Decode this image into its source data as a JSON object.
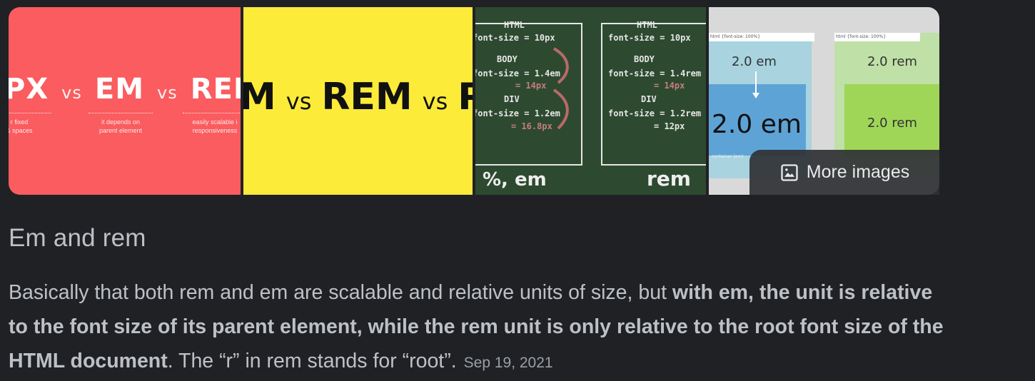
{
  "images": {
    "thumb1": {
      "words": [
        "PX",
        "vs",
        "EM",
        "vs",
        "REM"
      ],
      "captions": [
        "r fixed\n& spaces",
        "it depends on\nparent element",
        "easily scalable i\nresponsiveness"
      ]
    },
    "thumb2": {
      "words": [
        "M",
        "vs",
        "REM",
        "vs",
        "P"
      ]
    },
    "thumb3": {
      "left_lines": [
        "HTML",
        "font-size = 10px",
        "BODY",
        "font-size = 1.4em",
        "= 14px",
        "DIV",
        "font-size = 1.2em",
        "= 16.8px"
      ],
      "right_lines": [
        "HTML",
        "font-size = 10px",
        "BODY",
        "font-size = 1.4rem",
        "= 14px",
        "DIV",
        "font-size = 1.2rem",
        "= 12px"
      ],
      "left_label": "%, em",
      "right_label": "rem"
    },
    "thumb4": {
      "left_top": "2.0 em",
      "left_big": "2.0 em",
      "right_top": "2.0 rem",
      "right_bottom": "2.0 rem",
      "tiny_left": "html {font-size: 100%}",
      "tiny_right": "html {font-size: 100%}",
      "tiny_container": "container (em)"
    },
    "more_images_label": "More images",
    "colors": {
      "thumb1": "#fa5c5f",
      "thumb2": "#fdeb3a",
      "thumb3": "#2d4a30",
      "thumb4": "#d9d9d9"
    }
  },
  "result": {
    "title": "Em and rem",
    "snippet_part1": "Basically that both rem and em are scalable and relative units of size, but ",
    "snippet_bold": "with em, the unit is relative to the font size of its parent element, while the rem unit is only relative to the root font size of the HTML document",
    "snippet_part2": ". The “r” in rem stands for “root”.",
    "date": "Sep 19, 2021"
  }
}
